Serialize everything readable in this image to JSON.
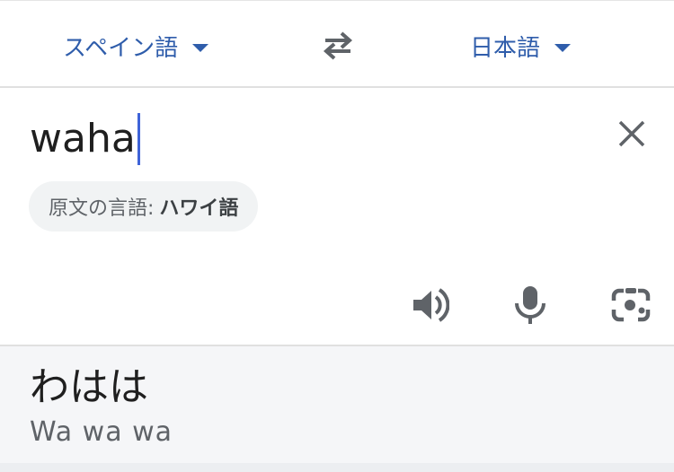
{
  "language_bar": {
    "source_language": "スペイン語",
    "target_language": "日本語",
    "swap_icon": "swap-arrows-icon"
  },
  "input": {
    "text": "waha",
    "clear_icon": "close-icon",
    "detected_prefix": "原文の言語:",
    "detected_language": "ハワイ語",
    "tools": {
      "speaker_icon": "speaker-icon",
      "mic_icon": "microphone-icon",
      "camera_icon": "camera-icon"
    }
  },
  "output": {
    "translation": "わはは",
    "romanization": "Wa wa wa"
  },
  "colors": {
    "accent": "#2f5dab",
    "cursor": "#3f63d8",
    "icon_gray": "#5f6368",
    "output_bg": "#f5f6f8"
  }
}
